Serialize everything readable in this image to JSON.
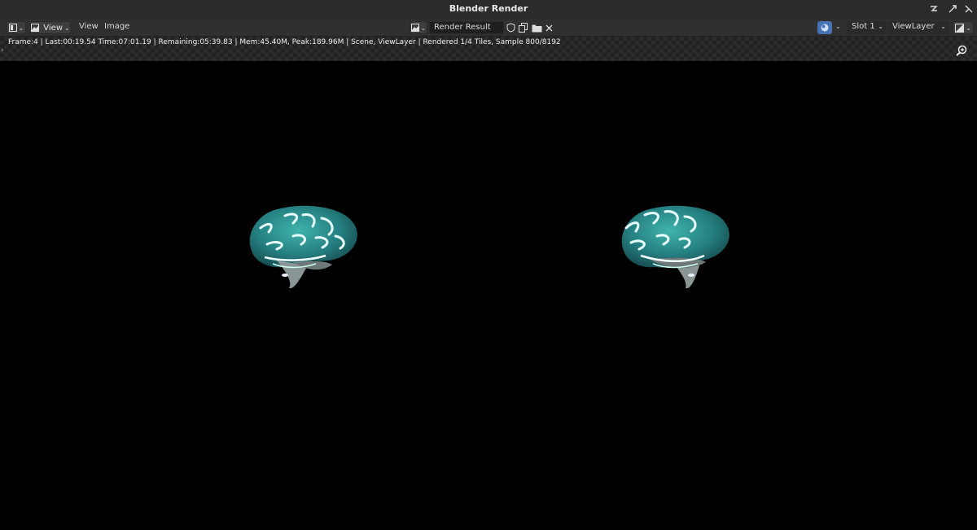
{
  "window": {
    "title": "Blender Render"
  },
  "header": {
    "editor_type_icon": "image-editor-icon",
    "view_mode_icon": "view-mode-icon",
    "menu_view": "View",
    "menu_view2": "View",
    "menu_image": "Image",
    "image_name": "Render Result",
    "slot": "Slot 1",
    "view_layer": "ViewLayer"
  },
  "info": {
    "stats": "Frame:4 | Last:00:19.54 Time:07:01.19 | Remaining:05:39.83 | Mem:45.40M, Peak:189.96M | Scene, ViewLayer | Rendered 1/4 Tiles, Sample 800/8192"
  },
  "colors": {
    "brain_teal": "#2f9f9c",
    "brain_dark": "#1b5f62",
    "highlight": "#e8ffff",
    "header_bg": "#303030",
    "accent_blue": "#4772b3"
  },
  "icons": [
    "zoom-icon",
    "hand-pan-icon",
    "shield-icon",
    "duplicate-icon",
    "folder-icon",
    "close-icon",
    "render-engine-icon",
    "display-channels-icon"
  ]
}
